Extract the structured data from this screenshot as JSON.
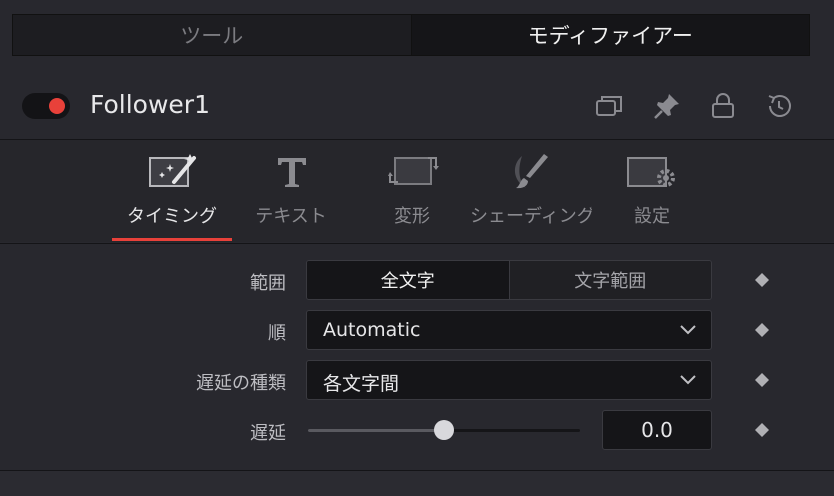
{
  "panel_tabs": [
    {
      "label": "ツール",
      "active": false
    },
    {
      "label": "モディファイアー",
      "active": true
    }
  ],
  "node": {
    "name": "Follower1",
    "enabled": true,
    "icons": [
      "copy-icon",
      "pin-icon",
      "lock-icon",
      "reset-icon"
    ]
  },
  "inspector_tabs": [
    {
      "label": "タイミング",
      "icon": "magic-wand-icon",
      "active": true
    },
    {
      "label": "テキスト",
      "icon": "text-icon",
      "active": false
    },
    {
      "label": "変形",
      "icon": "transform-icon",
      "active": false
    },
    {
      "label": "シェーディング",
      "icon": "brush-icon",
      "active": false
    },
    {
      "label": "設定",
      "icon": "settings-icon",
      "active": false
    }
  ],
  "properties": {
    "range": {
      "label": "範囲",
      "options": [
        "全文字",
        "文字範囲"
      ],
      "selected": 0
    },
    "order": {
      "label": "順",
      "value": "Automatic"
    },
    "delay_type": {
      "label": "遅延の種類",
      "value": "各文字間"
    },
    "delay": {
      "label": "遅延",
      "value": "0.0",
      "slider_fraction": 0.5
    }
  },
  "colors": {
    "accent_red": "#e8413a",
    "background": "#28282e",
    "field_bg": "#151518"
  }
}
